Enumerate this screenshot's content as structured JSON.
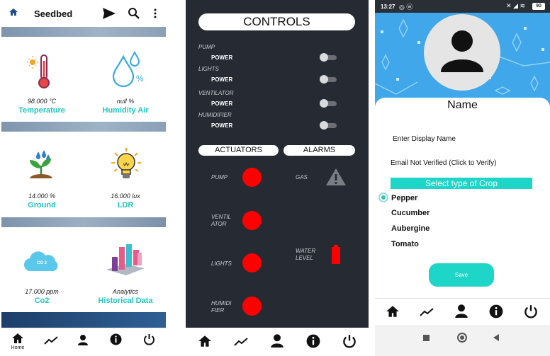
{
  "screen1": {
    "app_title": "Seedbed",
    "tiles": [
      {
        "value": "98.000 °C",
        "label": "Temperature",
        "icon": "thermometer-icon"
      },
      {
        "value": "null %",
        "label": "Humidity Air",
        "icon": "water-drops-icon"
      },
      {
        "value": "14.000 %",
        "label": "Ground",
        "icon": "sprout-icon"
      },
      {
        "value": "16.000 lux",
        "label": "LDR",
        "icon": "lightbulb-icon"
      },
      {
        "value": "17.000 ppm",
        "label": "Co2",
        "icon": "co2-cloud-icon"
      },
      {
        "value": "Analytics",
        "label": "Historical Data",
        "icon": "bar-chart-3d-icon"
      }
    ],
    "co2_badge": "CO 2",
    "humidity_symbol": "%",
    "nav_home_label": "Home"
  },
  "screen2": {
    "title": "CONTROLS",
    "controls": [
      {
        "device": "PUMP",
        "action": "POWER"
      },
      {
        "device": "LIGHTS",
        "action": "POWER"
      },
      {
        "device": "VENTILATOR",
        "action": "POWER"
      },
      {
        "device": "HUMIDIFIER",
        "action": "POWER"
      }
    ],
    "actuators_title": "ACTUATORS",
    "alarms_title": "ALARMS",
    "actuators": [
      "PUMP",
      "VENTIL ATOR",
      "LIGHTS",
      "HUMIDI FIER"
    ],
    "alarms": [
      "GAS",
      "WATER LEVEL"
    ],
    "indicator_color": "#ff0000"
  },
  "screen3": {
    "status_time": "13:27",
    "status_battery": "90",
    "name_heading": "Name",
    "display_name_placeholder": "Enter Display Name",
    "email_status": "Email Not Verified (Click to Verify)",
    "crop_header": "Select type of Crop",
    "crops": [
      "Pepper",
      "Cucumber",
      "Aubergine",
      "Tomato"
    ],
    "selected_crop": "Pepper",
    "save_label": "Save",
    "accent": "#1ed6c8"
  }
}
